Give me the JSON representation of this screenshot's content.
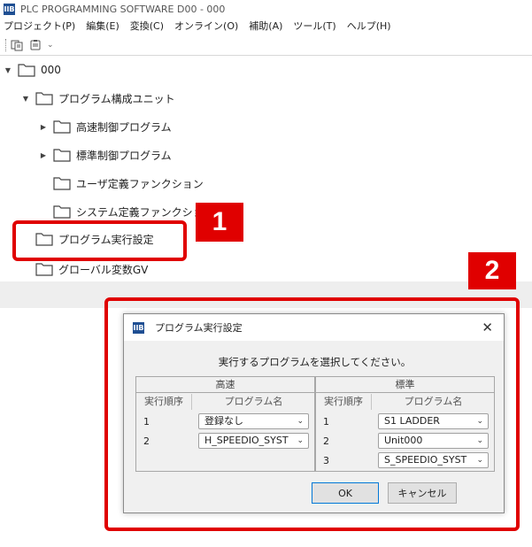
{
  "window": {
    "title": "PLC PROGRAMMING SOFTWARE D00  - 000",
    "icon_label": "IIB"
  },
  "menu": [
    "プロジェクト(P)",
    "編集(E)",
    "変換(C)",
    "オンライン(O)",
    "補助(A)",
    "ツール(T)",
    "ヘルプ(H)"
  ],
  "toolbar": {
    "icons": [
      "copy-icon",
      "paste-icon"
    ],
    "overflow": "⌄"
  },
  "tree": {
    "root": "000",
    "unit": "プログラム構成ユニット",
    "high_speed": "高速制御プログラム",
    "standard": "標準制御プログラム",
    "user_fn": "ユーザ定義ファンクション",
    "system_fn": "システム定義ファンクション",
    "exec_settings": "プログラム実行設定",
    "global_vars": "グローバル変数GV"
  },
  "callouts": {
    "one": "1",
    "two": "2",
    "color": "#e00000"
  },
  "dialog": {
    "title": "プログラム実行設定",
    "close": "✕",
    "prompt": "実行するプログラムを選択してください。",
    "high": {
      "title": "高速",
      "col_order": "実行順序",
      "col_name": "プログラム名",
      "rows": [
        {
          "order": "1",
          "value": "登録なし"
        },
        {
          "order": "2",
          "value": "H_SPEEDIO_SYST"
        }
      ]
    },
    "standard": {
      "title": "標準",
      "col_order": "実行順序",
      "col_name": "プログラム名",
      "rows": [
        {
          "order": "1",
          "value": "S1 LADDER"
        },
        {
          "order": "2",
          "value": "Unit000"
        },
        {
          "order": "3",
          "value": "S_SPEEDIO_SYST"
        }
      ]
    },
    "ok": "OK",
    "cancel": "キャンセル"
  }
}
